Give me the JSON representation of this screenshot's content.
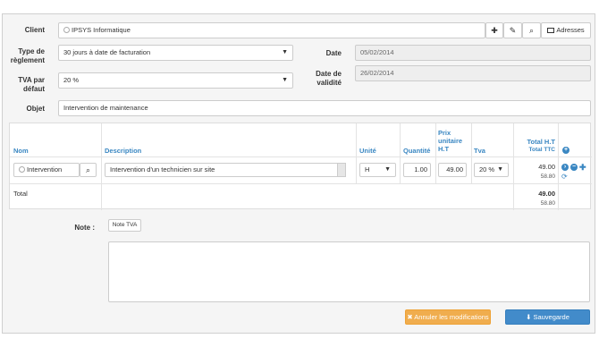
{
  "client": {
    "label": "Client",
    "value": "IPSYS Informatique",
    "btn_add": "✚",
    "btn_edit": "✎",
    "btn_search": "⌕",
    "btn_addresses": "Adresses"
  },
  "reglement": {
    "label_line1": "Type de",
    "label_line2": "règlement",
    "value": "30 jours à date de facturation"
  },
  "date": {
    "label": "Date",
    "value": "05/02/2014"
  },
  "tva": {
    "label_line1": "TVA par",
    "label_line2": "défaut",
    "value": "20 %"
  },
  "validite": {
    "label_line1": "Date de",
    "label_line2": "validité",
    "value": "26/02/2014"
  },
  "objet": {
    "label": "Objet",
    "value": "Intervention de maintenance"
  },
  "table": {
    "headers": {
      "nom": "Nom",
      "description": "Description",
      "unite": "Unité",
      "quantite": "Quantité",
      "prix_l1": "Prix",
      "prix_l2": "unitaire",
      "prix_l3": "H.T",
      "tva": "Tva",
      "total_ht": "Total H.T",
      "total_ttc": "Total TTC"
    },
    "row": {
      "nom": "Intervention",
      "description": "Intervention d'un technicien sur site",
      "unite": "H",
      "quantite": "1.00",
      "prix": "49.00",
      "tva": "20 %",
      "total_ht": "49.00",
      "total_ttc": "58.80"
    },
    "total": {
      "label": "Total",
      "ht": "49.00",
      "ttc": "58.80"
    }
  },
  "note": {
    "label": "Note :",
    "tag": "Note TVA"
  },
  "actions": {
    "cancel": "Annuler les modifications",
    "save": "Sauvegarde"
  },
  "colors": {
    "accent": "#3a87c2",
    "cancel": "#f0ad4e",
    "save": "#428bca"
  }
}
